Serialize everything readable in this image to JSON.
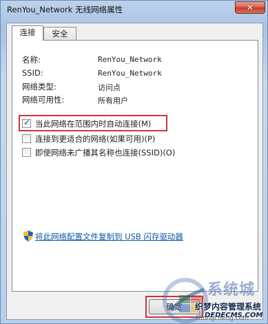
{
  "window": {
    "title": "RenYou_Network 无线网络属性",
    "close_label": "✕"
  },
  "tabs": [
    {
      "label": "连接",
      "active": true
    },
    {
      "label": "安全",
      "active": false
    }
  ],
  "properties": [
    {
      "label": "名称:",
      "value": "RenYou_Network"
    },
    {
      "label": "SSID:",
      "value": "RenYou_Network"
    },
    {
      "label": "网络类型:",
      "value": "访问点"
    },
    {
      "label": "网络可用性:",
      "value": "所有用户"
    }
  ],
  "options": [
    {
      "label": "当此网络在范围内时自动连接(M)",
      "checked": true
    },
    {
      "label": "连接到更适合的网络(如果可用)(P)",
      "checked": false
    },
    {
      "label": "即使网络未广播其名称也连接(SSID)(O)",
      "checked": false
    }
  ],
  "copy_link": "将此网络配置文件复制到 USB 闪存驱动器",
  "buttons": {
    "ok_label": "确定"
  },
  "icons": {
    "shield": "uac-shield-icon"
  },
  "watermark": {
    "brand": "系统城",
    "site_name": "织梦内容管理系统",
    "site_url": "DEDECMS.COM",
    "sub": "xitongcheng.com"
  },
  "colors": {
    "highlight": "#d1333c",
    "link": "#0b59a8"
  }
}
